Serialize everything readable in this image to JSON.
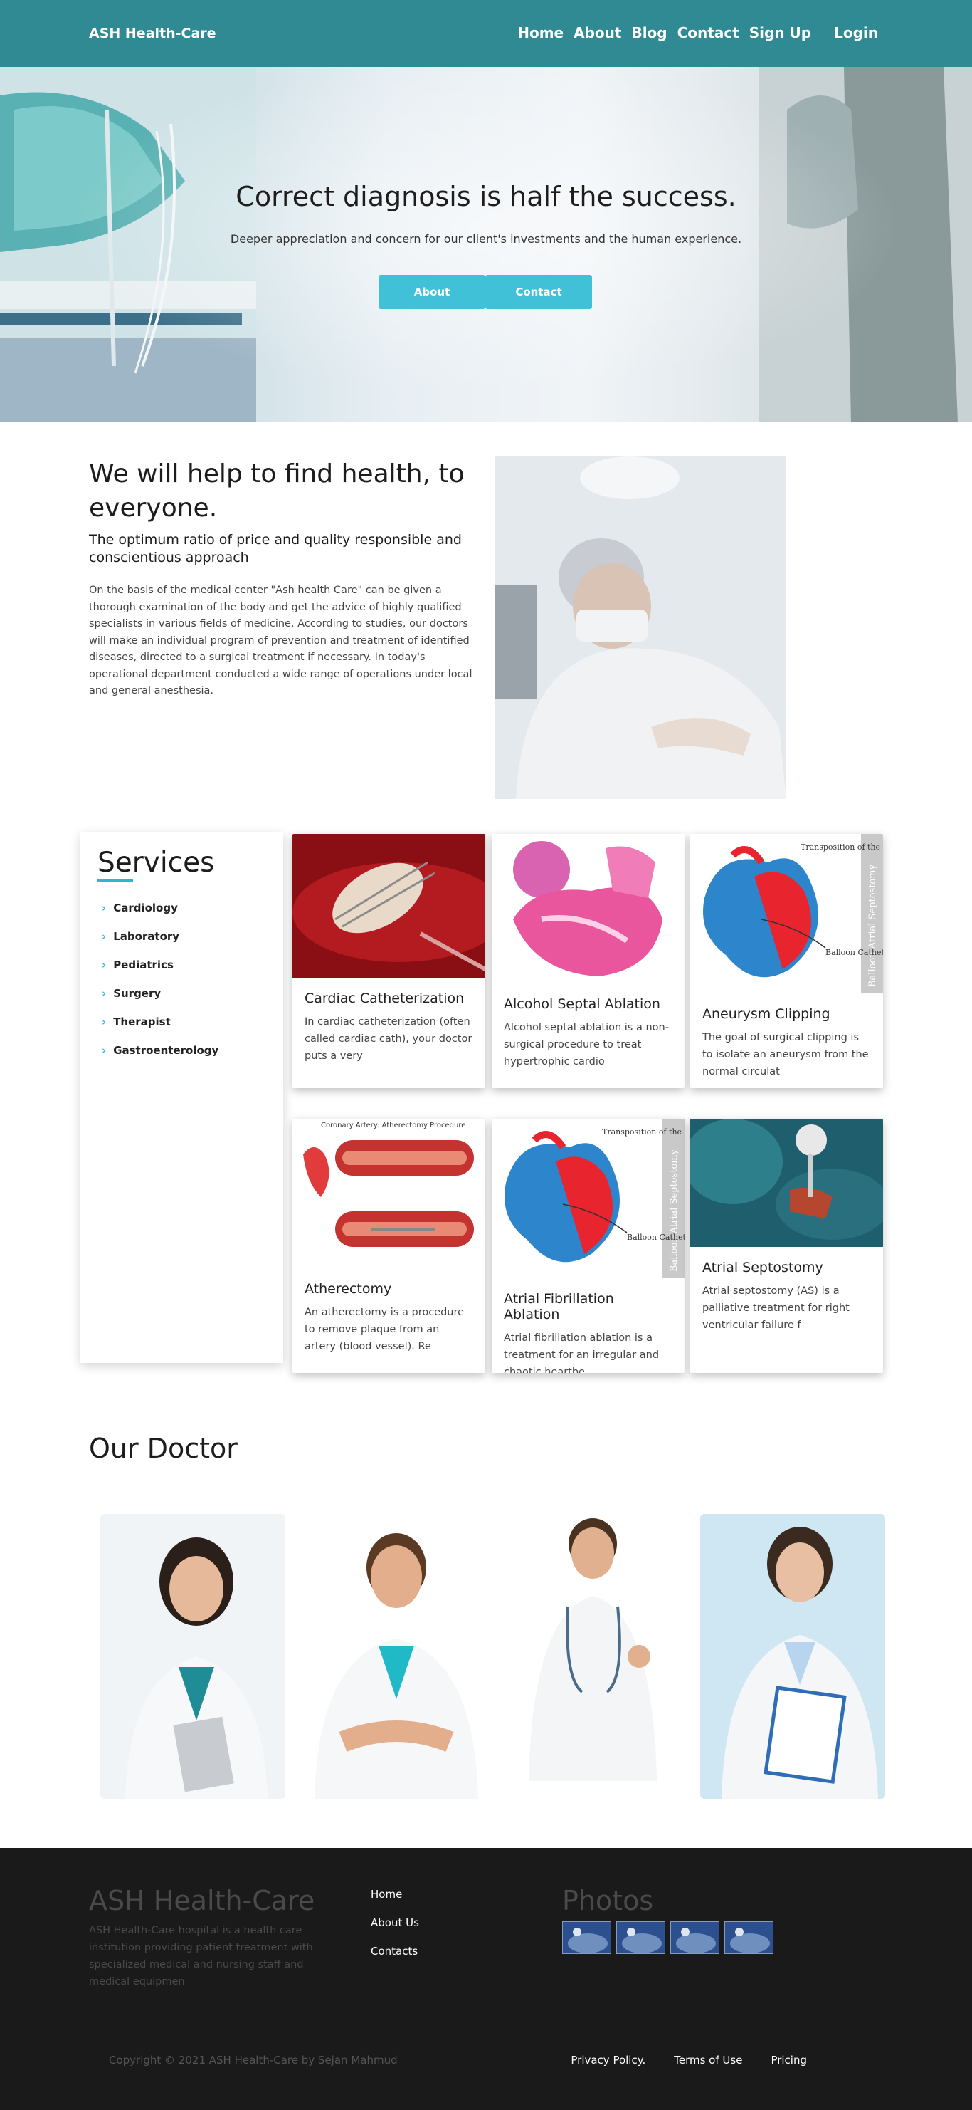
{
  "nav": {
    "brand": "ASH Health-Care",
    "links": [
      "Home",
      "About",
      "Blog",
      "Contact",
      "Sign Up"
    ],
    "login": "Login"
  },
  "hero": {
    "title": "Correct diagnosis is half the success.",
    "subtitle": "Deeper appreciation and concern for our client's investments and the human experience.",
    "btn_about": "About",
    "btn_contact": "Contact"
  },
  "about": {
    "heading": "We will help to find health, to everyone.",
    "subheading": "The optimum ratio of price and quality responsible and conscientious approach",
    "body": "On the basis of the medical center \"Ash health Care\" can be given a thorough examination of the body and get the advice of highly qualified specialists in various fields of medicine. According to studies, our doctors will make an individual program of prevention and treatment of identified diseases, directed to a surgical treatment if necessary. In today's operational department conducted a wide range of operations under local and general anesthesia."
  },
  "services": {
    "title": "Services",
    "items": [
      "Cardiology",
      "Laboratory",
      "Pediatrics",
      "Surgery",
      "Therapist",
      "Gastroenterology"
    ],
    "cards": [
      {
        "title": "Cardiac Catheterization",
        "desc": "In cardiac catheterization (often called cardiac cath), your doctor puts a very"
      },
      {
        "title": "Alcohol Septal Ablation",
        "desc": "Alcohol septal ablation is a non-surgical procedure to treat hypertrophic cardio"
      },
      {
        "title": "Aneurysm Clipping",
        "desc": "The goal of surgical clipping is to isolate an aneurysm from the normal circulat"
      },
      {
        "title": "Atherectomy",
        "desc": "An atherectomy is a procedure to remove plaque from an artery (blood vessel). Re"
      },
      {
        "title": "Atrial Fibrillation Ablation",
        "desc": "Atrial fibrillation ablation is a treatment for an irregular and chaotic heartbe"
      },
      {
        "title": "Atrial Septostomy",
        "desc": "Atrial septostomy (AS) is a palliative treatment for right ventricular failure f"
      }
    ],
    "image_labels": {
      "heart_side": "Balloon Atrial Septostomy",
      "transposition": "Transposition of the great Arteries",
      "balloon": "Balloon Catheter",
      "coronary": "Coronary Artery: Atherectomy Procedure"
    }
  },
  "doctors": {
    "title": "Our Doctor"
  },
  "footer": {
    "brand": "ASH Health-Care",
    "desc": "ASH Health-Care hospital is a health care institution providing patient treatment with specialized medical and nursing staff and medical equipmen",
    "links": [
      "Home",
      "About Us",
      "Contacts"
    ],
    "photos_title": "Photos",
    "copyright": "Copyright © 2021 ASH Health-Care by Sejan Mahmud",
    "legal": [
      "Privacy Policy.",
      "Terms of Use",
      "Pricing"
    ]
  },
  "colors": {
    "nav": "#2f8a93",
    "accent": "#41c1d7",
    "footer": "#1a1a1a"
  }
}
